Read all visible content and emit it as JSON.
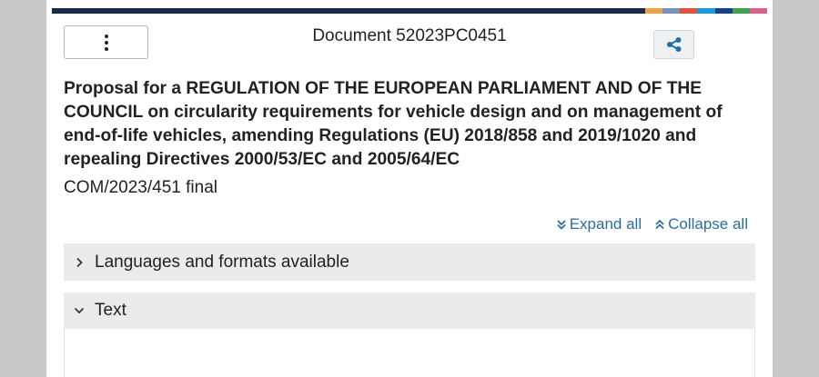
{
  "header": {
    "document_number": "Document 52023PC0451",
    "menu_icon": "kebab-vertical-icon",
    "share_icon": "share-icon"
  },
  "brand_colors": [
    "#f0a345",
    "#7b8fbf",
    "#e3513b",
    "#1a9ad6",
    "#163f8f",
    "#3fa34d",
    "#e35d8c"
  ],
  "document": {
    "title": "Proposal for a REGULATION OF THE EUROPEAN PARLIAMENT AND OF THE COUNCIL on circularity requirements for vehicle design and on management of end-of-life vehicles, amending Regulations (EU) 2018/858 and 2019/1020 and repealing Directives 2000/53/EC and 2005/64/EC",
    "reference": "COM/2023/451 final"
  },
  "controls": {
    "expand_all": "Expand all",
    "collapse_all": "Collapse all",
    "accent_color": "#2b6e9e"
  },
  "panels": [
    {
      "label": "Languages and formats available",
      "state": "collapsed"
    },
    {
      "label": "Text",
      "state": "expanded"
    }
  ]
}
